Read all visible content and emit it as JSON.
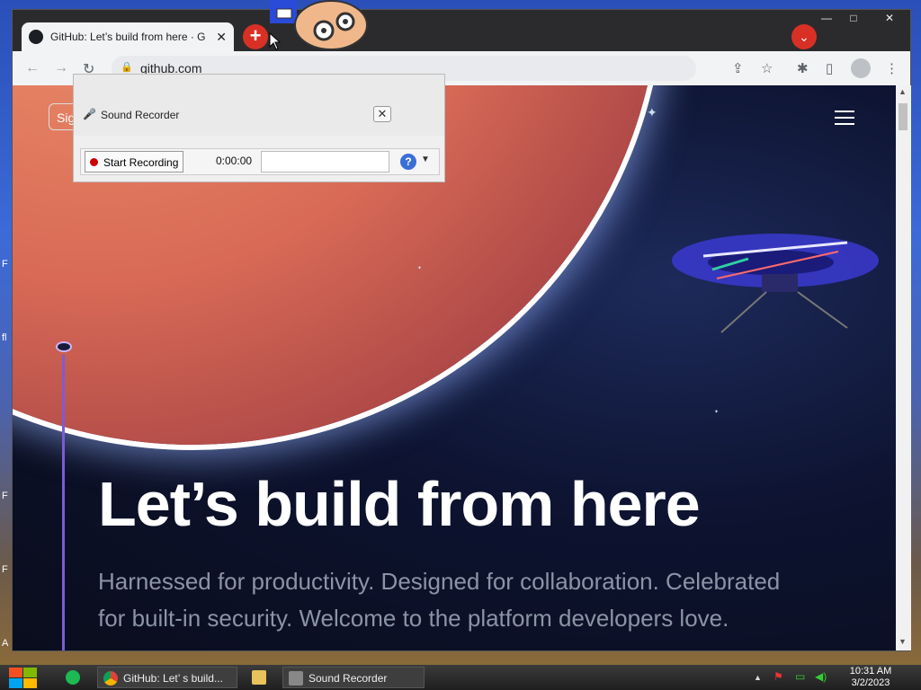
{
  "desktop": {
    "edge_labels": [
      "F",
      "fl",
      "F",
      "F",
      "A"
    ]
  },
  "browser": {
    "tab_title": "GitHub: Let’s build from here · G",
    "tab_close": "✕",
    "new_tab": "+",
    "profile_menu": "⌄",
    "window_buttons": {
      "minimize": "—",
      "maximize": "□",
      "close": "✕"
    },
    "nav": {
      "back": "←",
      "forward": "→",
      "reload": "↻"
    },
    "url": "github.com",
    "toolbar_icons": {
      "share": "⇪",
      "bookmark": "☆",
      "extensions": "✱",
      "sidepanel": "▯",
      "menu": "⋮"
    }
  },
  "page": {
    "sign_button": "Sig",
    "hero_title": "Let’s build from here",
    "hero_subtitle": "Harnessed for productivity. Designed for collaboration. Celebrated for built-in security. Welcome to the platform developers love."
  },
  "recorder": {
    "title": "Sound Recorder",
    "start_label": "Start Recording",
    "time": "0:00:00",
    "help": "?"
  },
  "taskbar": {
    "apps": [
      {
        "label": "GitHub: Let’ s build..."
      },
      {
        "label": ""
      },
      {
        "label": "Sound Recorder"
      }
    ],
    "tray_arrow": "▲",
    "clock_time": "10:31 AM",
    "clock_date": "3/2/2023"
  },
  "colors": {
    "accent_red": "#d93025",
    "github_bg": "#0d1330",
    "taskbar": "#2a2a2a"
  }
}
